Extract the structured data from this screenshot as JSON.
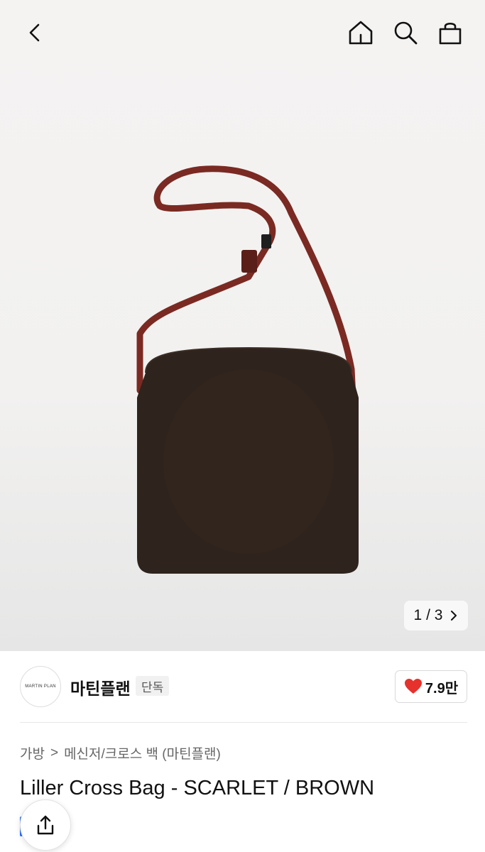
{
  "header": {
    "icons": [
      "back-icon",
      "home-icon",
      "search-icon",
      "shopping-bag-icon"
    ]
  },
  "gallery": {
    "current": "1",
    "separator": "/",
    "total": "3"
  },
  "brand": {
    "logo_text": "MARTIN PLAN",
    "name": "마틴플랜",
    "tag": "단독"
  },
  "like": {
    "count": "7.9만",
    "color": "#e5322d"
  },
  "breadcrumb": {
    "category": "가방",
    "separator": ">",
    "subcategory": "메신저/크로스 백 (마틴플랜)"
  },
  "product": {
    "title": "Liller Cross Bag - SCARLET / BROWN"
  },
  "colors": {
    "bag_body": "#2e231d",
    "strap": "#7a2a22",
    "accent_blue": "#2b6cff"
  }
}
